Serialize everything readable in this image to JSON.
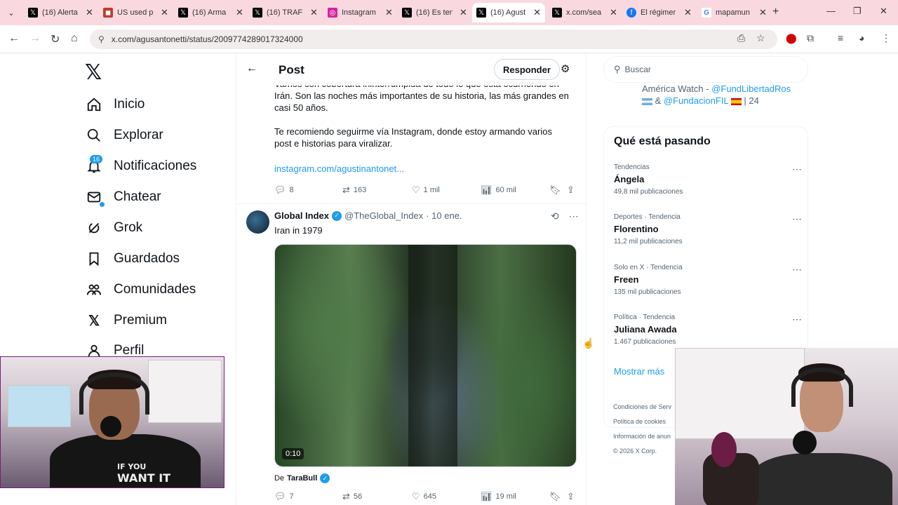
{
  "browser": {
    "tabs": [
      {
        "title": "(16) Alerta",
        "icon": "x-icon",
        "color": "#000000"
      },
      {
        "title": "US used p",
        "icon": "red-square-icon",
        "color": "#c0392b"
      },
      {
        "title": "(16) Arma",
        "icon": "x-icon",
        "color": "#000000"
      },
      {
        "title": "(16) TRAFI",
        "icon": "x-icon",
        "color": "#000000"
      },
      {
        "title": "Instagram",
        "icon": "instagram-icon",
        "color": "#d6249f"
      },
      {
        "title": "(16) Es ten",
        "icon": "x-icon",
        "color": "#000000"
      },
      {
        "title": "(16) Agust",
        "icon": "x-icon",
        "color": "#000000",
        "active": true
      },
      {
        "title": "x.com/sea",
        "icon": "x-icon",
        "color": "#000000"
      },
      {
        "title": "El régimer",
        "icon": "facebook-icon",
        "color": "#1877f2"
      },
      {
        "title": "mapamun",
        "icon": "google-icon",
        "color": "#4285f4"
      }
    ],
    "url": "x.com/agusantonetti/status/2009774289017324000"
  },
  "sidebar": {
    "items": [
      {
        "label": "Inicio",
        "icon": "home-icon"
      },
      {
        "label": "Explorar",
        "icon": "search-icon"
      },
      {
        "label": "Notificaciones",
        "icon": "bell-icon"
      },
      {
        "label": "Chatear",
        "icon": "mail-icon"
      },
      {
        "label": "Grok",
        "icon": "grok-icon"
      },
      {
        "label": "Guardados",
        "icon": "bookmark-icon"
      },
      {
        "label": "Comunidades",
        "icon": "communities-icon"
      },
      {
        "label": "Premium",
        "icon": "x-premium-icon"
      },
      {
        "label": "Perfil",
        "icon": "profile-icon"
      }
    ],
    "notification_badge": "16"
  },
  "main": {
    "header_title": "Post",
    "reply_label": "Responder",
    "previous_post": {
      "line1": "Vamos con cobertura ininterrumpida de todo lo que está ocurriendo en Irán. Son las noches más importantes de su historia, las más grandes en casi 50 años.",
      "line2": "Te recomiendo seguirme vía Instagram, donde estoy armando varios post e historias para viralizar.",
      "link": "instagram.com/agustinantonet...",
      "replies": "8",
      "reposts": "163",
      "likes": "1 mil",
      "views": "60 mil"
    },
    "tweet": {
      "name": "Global Index",
      "handle": "@TheGlobal_Index",
      "date": "· 10 ene.",
      "text": "Iran in 1979",
      "video_duration": "0:10",
      "from_label": "De",
      "from_user": "TaraBull",
      "replies": "7",
      "reposts": "56",
      "likes": "645",
      "views": "19 mil"
    }
  },
  "right": {
    "search_placeholder": "Buscar",
    "sponsor_line1_prefix": "América Watch - ",
    "sponsor_line1_link": "@FundLibertadRos",
    "sponsor_line2_amp": "&",
    "sponsor_line2_link": "@FundacionFIL",
    "sponsor_line2_suffix": "| 24",
    "trends_title": "Qué está pasando",
    "trends": [
      {
        "meta": "Tendencias",
        "name": "Ángela",
        "count": "49,8 mil publicaciones"
      },
      {
        "meta": "Deportes · Tendencia",
        "name": "Florentino",
        "count": "11,2 mil publicaciones"
      },
      {
        "meta": "Solo en X · Tendencia",
        "name": "Freen",
        "count": "135 mil publicaciones"
      },
      {
        "meta": "Política · Tendencia",
        "name": "Juliana Awada",
        "count": "1.467 publicaciones"
      }
    ],
    "show_more": "Mostrar más",
    "footer": [
      "Condiciones de Serv",
      "Política de cookies",
      "Información de anun",
      "© 2026 X Corp."
    ]
  },
  "webcam": {
    "shirt_text_1": "IF YOU",
    "shirt_text_2": "WANT IT"
  },
  "colors": {
    "accent": "#1d9bf0",
    "tabbar": "#f9d9df"
  }
}
